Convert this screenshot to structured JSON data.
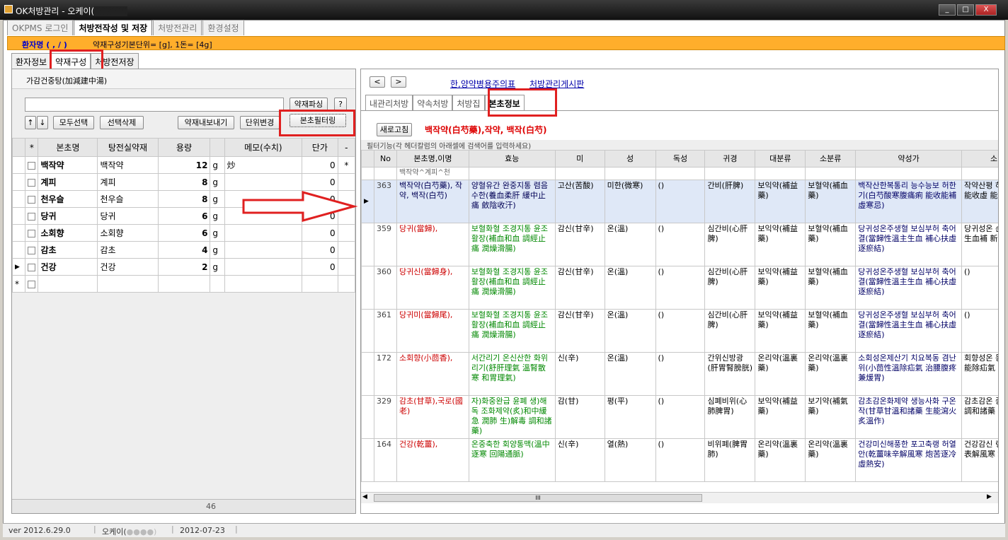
{
  "window": {
    "title": "OK처방관리 - 오케이(",
    "title_hidden": "●●●●)",
    "min": "_",
    "max": "□",
    "close": "X"
  },
  "toptabs": [
    "OKPMS 로그인",
    "처방전작성 및 저장",
    "처방전관리",
    "환경설정"
  ],
  "patient": {
    "label": "환자명 ( , / )",
    "info": "약재구성기본단위= [g], 1돈= [4g]"
  },
  "subtabs": [
    "환자정보",
    "약재구성",
    "처방전저장"
  ],
  "left": {
    "prescription_name": "가감건중탕(加減建中湯)",
    "btn_search": "약재파싱",
    "btn_help": "?",
    "btn_up": "↑",
    "btn_down": "↓",
    "btn_select_all": "모두선택",
    "btn_delete": "선택삭제",
    "btn_export": "약재내보내기",
    "btn_unit": "단위변경",
    "btn_filter": "본초필터링",
    "columns": [
      "*",
      "본초명",
      "탕전실약재",
      "용량",
      "",
      "메모(수치)",
      "단가",
      "-"
    ],
    "rows": [
      {
        "herb": "백작약",
        "tang": "백작약",
        "dose": "12",
        "unit": "g",
        "memo": "炒",
        "price": "0",
        "star": "*"
      },
      {
        "herb": "계피",
        "tang": "계피",
        "dose": "8",
        "unit": "g",
        "memo": "",
        "price": "0",
        "star": ""
      },
      {
        "herb": "천우슬",
        "tang": "천우슬",
        "dose": "8",
        "unit": "g",
        "memo": "",
        "price": "0",
        "star": ""
      },
      {
        "herb": "당귀",
        "tang": "당귀",
        "dose": "6",
        "unit": "g",
        "memo": "",
        "price": "0",
        "star": ""
      },
      {
        "herb": "소회향",
        "tang": "소회향",
        "dose": "6",
        "unit": "g",
        "memo": "",
        "price": "0",
        "star": ""
      },
      {
        "herb": "감초",
        "tang": "감초",
        "dose": "4",
        "unit": "g",
        "memo": "",
        "price": "0",
        "star": ""
      },
      {
        "herb": "건강",
        "tang": "건강",
        "dose": "2",
        "unit": "g",
        "memo": "",
        "price": "0",
        "star": ""
      }
    ],
    "total": "46"
  },
  "right": {
    "nav_prev": "<",
    "nav_next": ">",
    "links": [
      "한,양약병용주의표",
      "처방관리게시판"
    ],
    "tabs": [
      "내관리처방",
      "약속처방",
      "처방집",
      "본초정보"
    ],
    "btn_refresh": "새로고침",
    "selected_herb": "백작약(白芍藥),작약, 백작(白芍)",
    "filter_hint": "필터기능(각 헤더칼럼의 아래셀에 검색어를 입력하세요)",
    "filter_value": "백작약^계피^천",
    "columns": [
      "No",
      "본초명,이명",
      "효능",
      "미",
      "성",
      "독성",
      "귀경",
      "대분류",
      "소분류",
      "약성가",
      "소"
    ],
    "rows": [
      {
        "no": "363",
        "name": "백작약(白芍藥), 작약, 백작(白芍)",
        "eff": "양혈유간 완중지통 렴음수한(養血柔肝 緩中止痛 斂陰收汗)",
        "mi": "고산(苦酸)",
        "sung": "미한(微寒)",
        "tox": "()",
        "gui": "간비(肝脾)",
        "big": "보익약(補益藥)",
        "small": "보혈약(補血藥)",
        "yak": "백작산한복통리 능수능보 허한기(白芍酸寒腹痛痢 能收能補虛寒忌)",
        "so": "작약산평 하 백수 能收虛 能(收))"
      },
      {
        "no": "359",
        "name": "당귀(當歸),",
        "eff": "보혈화혈 조경지통 윤조활장(補血和血 調經止痛 潤燥滑腸)",
        "mi": "감신(甘辛)",
        "sung": "온(溫)",
        "tox": "()",
        "gui": "심간비(心肝脾)",
        "big": "보익약(補益藥)",
        "small": "보혈약(補血藥)",
        "yak": "당귀성온주생혈 보심부허 축어결(當歸性溫主生血 補心扶虛逐瘀結)",
        "so": "당귀성온 손 축어 生血補 新))"
      },
      {
        "no": "360",
        "name": "당귀신(當歸身),",
        "eff": "보혈화혈 조경지통 윤조활장(補血和血 調經止痛 潤燥滑腸)",
        "mi": "감신(甘辛)",
        "sung": "온(溫)",
        "tox": "()",
        "gui": "심간비(心肝脾)",
        "big": "보익약(補益藥)",
        "small": "보혈약(補血藥)",
        "yak": "당귀성온주생혈 보심부허 축어결(當歸性溫主生血 補心扶虛逐瘀結)",
        "so": "()"
      },
      {
        "no": "361",
        "name": "당귀미(當歸尾),",
        "eff": "보혈화혈 조경지통 윤조활장(補血和血 調經止痛 潤燥滑腸)",
        "mi": "감신(甘辛)",
        "sung": "온(溫)",
        "tox": "()",
        "gui": "심간비(心肝脾)",
        "big": "보익약(補益藥)",
        "small": "보혈약(補血藥)",
        "yak": "당귀성온주생혈 보심부허 축어결(當歸性溫主生血 補心扶虛逐瘀結)",
        "so": "()"
      },
      {
        "no": "172",
        "name": "소회향(小茴香),",
        "eff": "서간리기 온신산한 화위리기(舒肝理氣 溫腎散寒 和胃理氣)",
        "mi": "신(辛)",
        "sung": "온(溫)",
        "tox": "()",
        "gui": "간위신방광(肝胃腎膀胱)",
        "big": "온리약(溫裏藥)",
        "small": "온리약(溫裏藥)",
        "yak": "소회성온제산기 치요복동 겸난위(小茴性溫除疝氣 治腰腹疼兼煖胃)",
        "so": "회향성온 동 조중 能除疝氣 胃(熱))"
      },
      {
        "no": "329",
        "name": "감초(甘草),국로(國老)",
        "eff": "자)화중완급 윤폐 생)해독 조화제약(炙)和中緩急 潤肺 生)解毒 調和諸藥)",
        "mi": "감(甘)",
        "sung": "평(平)",
        "tox": "()",
        "gui": "심폐비위(心肺脾胃)",
        "big": "보익약(補益藥)",
        "small": "보기약(補氣藥)",
        "yak": "감초감온화제약 생능사화 구온작(甘草甘溫和諸藥 生能瀉火炙溫作)",
        "so": "감초감온 중 생현 調和諸藥 火(補))"
      },
      {
        "no": "164",
        "name": "건강(乾薑),",
        "eff": "온중축한 회양통맥(溫中逐寒 回陽通脈)",
        "mi": "신(辛)",
        "sung": "열(熱)",
        "tox": "()",
        "gui": "비위폐(脾胃肺)",
        "big": "온리약(溫裏藥)",
        "small": "온리약(溫裏藥)",
        "yak": "건강미신해풍한 포고축랭 허열안(乾薑味辛解風寒 炮苦逐冷虛熱安)",
        "so": "건강감신 랭 허열 表解風寒 堪(熱))"
      }
    ],
    "hscroll_grip": "III"
  },
  "status": {
    "version": "ver 2012.6.29.0",
    "user": "오케이(",
    "user_hidden": "●●●●)",
    "date": "2012-07-23"
  }
}
